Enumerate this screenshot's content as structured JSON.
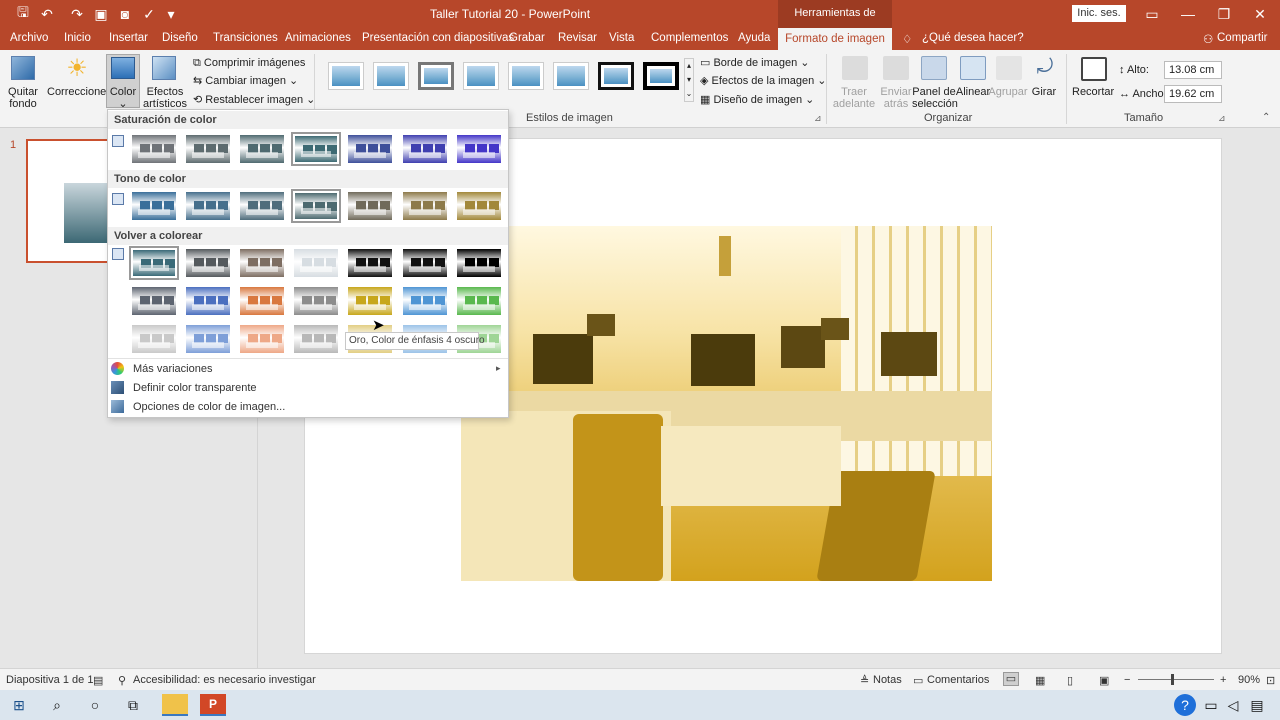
{
  "app": {
    "title": "Taller Tutorial 20  -  PowerPoint",
    "context_tools": "Herramientas de imagen",
    "signin": "Inic. ses."
  },
  "tabs": [
    "Archivo",
    "Inicio",
    "Insertar",
    "Diseño",
    "Transiciones",
    "Animaciones",
    "Presentación con diapositivas",
    "Grabar",
    "Revisar",
    "Vista",
    "Complementos",
    "Ayuda"
  ],
  "active_tab": "Formato de imagen",
  "tell_me": "¿Qué desea hacer?",
  "share": "Compartir",
  "ribbon": {
    "quitar_fondo": [
      "Quitar",
      "fondo"
    ],
    "correcciones": "Correcciones",
    "color": "Color",
    "efectos": [
      "Efectos",
      "artísticos"
    ],
    "comprimir": "Comprimir imágenes",
    "cambiar": "Cambiar imagen",
    "restablecer": "Restablecer imagen",
    "borde": "Borde de imagen",
    "efectos_imagen": "Efectos de la imagen",
    "diseno_imagen": "Diseño de imagen",
    "traer": [
      "Traer",
      "adelante"
    ],
    "enviar": [
      "Enviar",
      "atrás"
    ],
    "panel": [
      "Panel de",
      "selección"
    ],
    "alinear": "Alinear",
    "agrupar": "Agrupar",
    "girar": "Girar",
    "recortar": "Recortar",
    "alto_label": "Alto:",
    "alto_value": "13.08 cm",
    "ancho_label": "Ancho:",
    "ancho_value": "19.62 cm",
    "group_estilos": "Estilos de imagen",
    "group_organizar": "Organizar",
    "group_tamano": "Tamaño"
  },
  "dropdown": {
    "saturacion": "Saturación de color",
    "tono": "Tono de color",
    "volver": "Volver a colorear",
    "tooltip": "Oro, Color de énfasis 4 oscuro",
    "mas": "Más variaciones",
    "transparente": "Definir color transparente",
    "opciones": "Opciones de color de imagen...",
    "saturation_colors": [
      "#6f7378",
      "#5d6b6f",
      "#4f6a70",
      "#3d6a73",
      "#3e4f9a",
      "#3f3fb0",
      "#4436c8"
    ],
    "tone_colors": [
      "#3a6f9a",
      "#466f8c",
      "#4f6d7c",
      "#4d6a70",
      "#706a5a",
      "#8d7a4a",
      "#a2883a"
    ],
    "recolor_row1": [
      "#3a6a78",
      "#555a5e",
      "#7e6e62",
      "#d7dde2",
      "#111111",
      "#111111",
      "#000000"
    ],
    "recolor_row2": [
      "#5d6470",
      "#4b6fbf",
      "#d9783f",
      "#8c8c8c",
      "#c7a71c",
      "#4f95d4",
      "#59b84e"
    ],
    "recolor_row3": [
      "#c9c9c9",
      "#7e9fd8",
      "#eea887",
      "#b8b8b8",
      "#e2ce84",
      "#9cc3e8",
      "#9fd596"
    ]
  },
  "slide": {
    "number": "1"
  },
  "status": {
    "slide_info": "Diapositiva 1 de 1",
    "accesibilidad": "Accesibilidad: es necesario investigar",
    "notas": "Notas",
    "comentarios": "Comentarios",
    "zoom": "90%"
  }
}
